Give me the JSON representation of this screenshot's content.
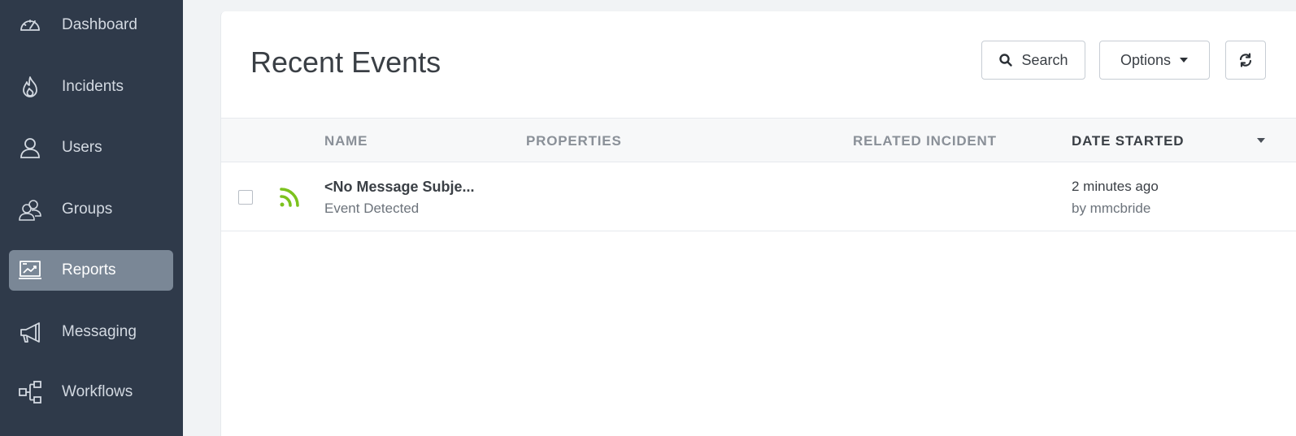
{
  "sidebar": {
    "items": [
      {
        "label": "Dashboard",
        "icon": "speedometer-icon",
        "active": false
      },
      {
        "label": "Incidents",
        "icon": "flame-icon",
        "active": false
      },
      {
        "label": "Users",
        "icon": "user-icon",
        "active": false
      },
      {
        "label": "Groups",
        "icon": "users-group-icon",
        "active": false
      },
      {
        "label": "Reports",
        "icon": "report-chart-icon",
        "active": true
      },
      {
        "label": "Messaging",
        "icon": "megaphone-icon",
        "active": false
      },
      {
        "label": "Workflows",
        "icon": "workflow-icon",
        "active": false
      }
    ]
  },
  "main": {
    "title": "Recent Events",
    "search_label": "Search",
    "options_label": "Options",
    "table": {
      "columns": [
        "NAME",
        "PROPERTIES",
        "RELATED INCIDENT",
        "DATE STARTED"
      ],
      "sorted_column": "DATE STARTED",
      "rows": [
        {
          "name": "<No Message Subje...",
          "status": "Event Detected",
          "properties": "",
          "related_incident": "",
          "date": "2 minutes ago",
          "by": "by mmcbride",
          "icon": "rss-feed-icon"
        }
      ]
    }
  },
  "colors": {
    "sidebar_bg": "#2f3a4a",
    "active_item_bg": "#7a8796",
    "feed_icon": "#7cc21e"
  }
}
